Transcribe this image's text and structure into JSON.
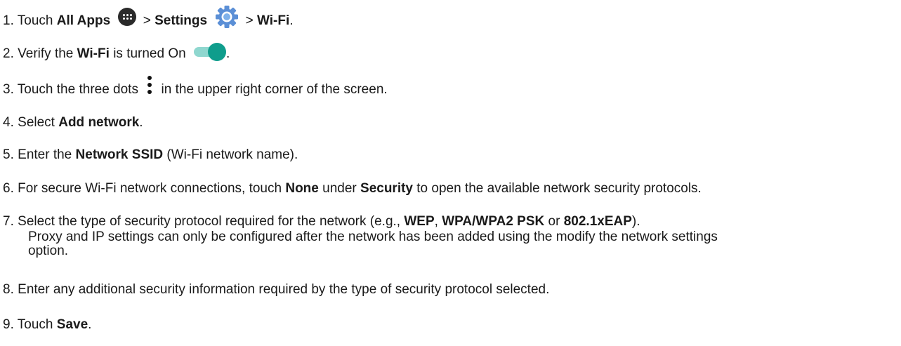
{
  "steps": [
    {
      "num": "1.",
      "parts": [
        "Touch",
        "All Apps",
        ">",
        "Settings",
        ">",
        "Wi-Fi",
        "."
      ],
      "icons": [
        "all-apps-icon",
        "settings-gear-icon"
      ]
    },
    {
      "num": "2.",
      "parts": [
        "Verify the",
        "Wi-Fi",
        "is turned On",
        "."
      ],
      "icons": [
        "toggle-on-icon"
      ]
    },
    {
      "num": "3.",
      "parts": [
        "Touch the three dots",
        "in the upper right corner of the screen."
      ],
      "icons": [
        "three-dots-menu-icon"
      ]
    },
    {
      "num": "4.",
      "parts": [
        "Select",
        "Add network",
        "."
      ]
    },
    {
      "num": "5.",
      "parts": [
        "Enter the",
        "Network SSID",
        "(Wi-Fi network name)."
      ]
    },
    {
      "num": "6.",
      "parts": [
        "For secure Wi-Fi network connections, touch",
        "None",
        "under",
        "Security",
        "to open the available network security protocols."
      ]
    },
    {
      "num": "7.",
      "parts": [
        "Select the type of security protocol required for the network (e.g.,",
        "WEP",
        ",",
        "WPA/WPA2 PSK",
        "or",
        "802.1xEAP",
        ")."
      ],
      "note": [
        "Proxy and IP settings can only be configured after the network has been added using the modify the network settings",
        "option."
      ]
    },
    {
      "num": "8.",
      "parts": [
        "Enter any additional security information required by the type of security protocol selected."
      ]
    },
    {
      "num": "9.",
      "parts": [
        "Touch",
        "Save",
        "."
      ]
    }
  ],
  "colors": {
    "text": "#1a1a1a",
    "toggle_knob": "#0f9d8c",
    "toggle_track": "#8fd7cf",
    "apps_icon": "#2a2a2a",
    "gear": "#5b8fd6"
  }
}
